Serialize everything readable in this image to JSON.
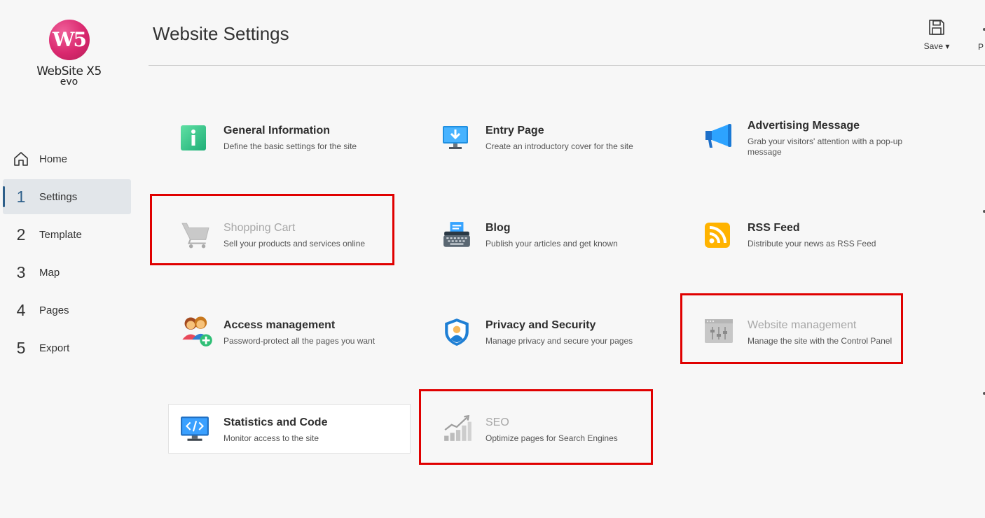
{
  "app": {
    "logo_mark": "W5",
    "logo_name": "WebSite X5",
    "logo_sub": "evo"
  },
  "nav": {
    "items": [
      {
        "num": "",
        "label": "Home",
        "icon": "home-icon"
      },
      {
        "num": "1",
        "label": "Settings",
        "active": true
      },
      {
        "num": "2",
        "label": "Template"
      },
      {
        "num": "3",
        "label": "Map"
      },
      {
        "num": "4",
        "label": "Pages"
      },
      {
        "num": "5",
        "label": "Export"
      }
    ]
  },
  "header": {
    "title": "Website Settings",
    "save_label": "Save ▾",
    "partial_label": "P"
  },
  "cards": [
    {
      "title": "General Information",
      "desc": "Define the basic settings for the site",
      "icon": "info-icon"
    },
    {
      "title": "Entry Page",
      "desc": "Create an introductory cover for the site",
      "icon": "monitor-download-icon"
    },
    {
      "title": "Advertising Message",
      "desc": "Grab your visitors' attention with a pop-up message",
      "icon": "megaphone-icon"
    },
    {
      "title": "Shopping Cart",
      "desc": "Sell your products and services online",
      "icon": "cart-icon",
      "disabled": true
    },
    {
      "title": "Blog",
      "desc": "Publish your articles and get known",
      "icon": "typewriter-icon"
    },
    {
      "title": "RSS Feed",
      "desc": "Distribute your news as RSS Feed",
      "icon": "rss-icon"
    },
    {
      "title": "Access management",
      "desc": "Password-protect all the pages you want",
      "icon": "users-add-icon"
    },
    {
      "title": "Privacy and Security",
      "desc": "Manage privacy and secure your pages",
      "icon": "shield-user-icon"
    },
    {
      "title": "Website management",
      "desc": "Manage the site with the Control Panel",
      "icon": "control-panel-icon",
      "disabled": true
    },
    {
      "title": "Statistics and Code",
      "desc": "Monitor access to the site",
      "icon": "code-monitor-icon"
    },
    {
      "title": "SEO",
      "desc": "Optimize pages for Search Engines",
      "icon": "chart-growth-icon",
      "disabled": true
    }
  ],
  "colors": {
    "highlight": "#e00000",
    "accent": "#2d5f8a",
    "logo": "#d9286e"
  }
}
